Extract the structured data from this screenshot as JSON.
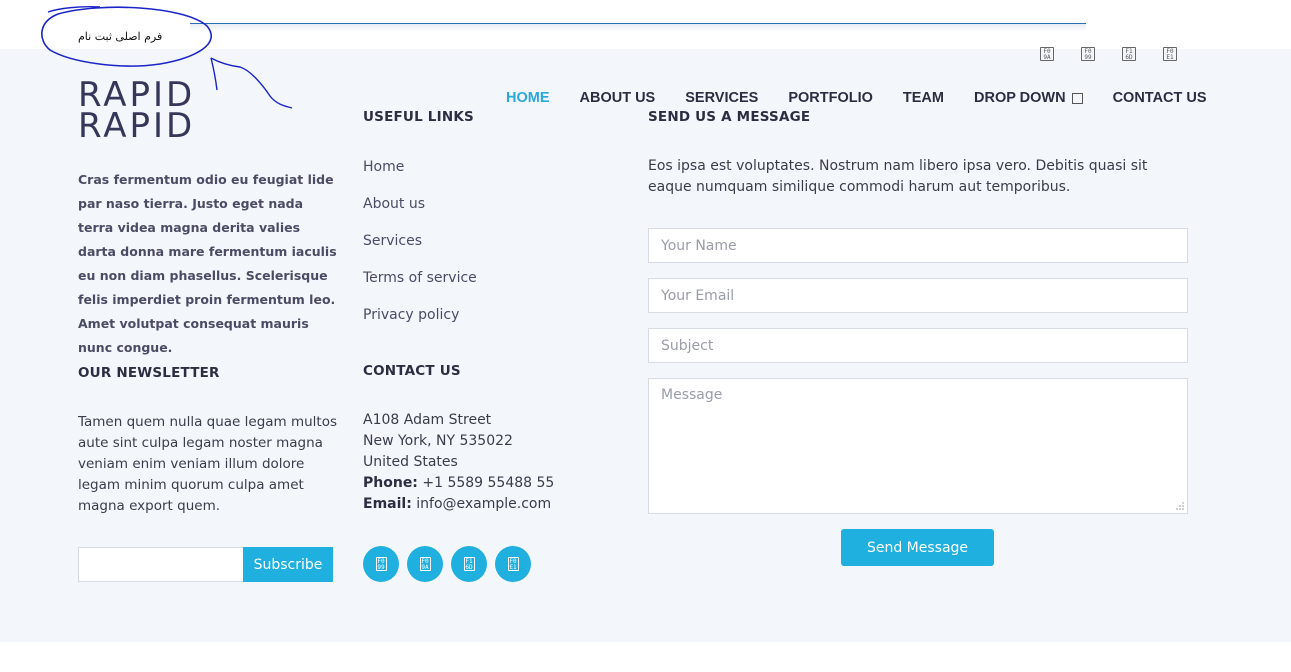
{
  "annotation": {
    "text": "فرم اصلی ثبت نام"
  },
  "top_social": [
    "facebook-icon",
    "twitter-icon",
    "instagram-icon",
    "linkedin-icon"
  ],
  "nav": {
    "items": [
      {
        "label": "HOME",
        "active": true
      },
      {
        "label": "ABOUT US"
      },
      {
        "label": "SERVICES"
      },
      {
        "label": "PORTFOLIO"
      },
      {
        "label": "TEAM"
      },
      {
        "label": "DROP DOWN"
      },
      {
        "label": "CONTACT US"
      }
    ]
  },
  "logo": {
    "line1": "RAPID",
    "line2": "RAPID"
  },
  "about": {
    "text": "Cras fermentum odio eu feugiat lide par naso tierra. Justo eget nada terra videa magna derita valies darta donna mare fermentum iaculis eu non diam phasellus. Scelerisque felis imperdiet proin fermentum leo. Amet volutpat consequat mauris nunc congue."
  },
  "newsletter": {
    "heading": "OUR NEWSLETTER",
    "text": "Tamen quem nulla quae legam multos aute sint culpa legam noster magna veniam enim veniam illum dolore legam minim quorum culpa amet magna export quem.",
    "button": "Subscribe"
  },
  "useful_links": {
    "heading": "USEFUL LINKS",
    "items": [
      "Home",
      "About us",
      "Services",
      "Terms of service",
      "Privacy policy"
    ]
  },
  "contact": {
    "heading": "CONTACT US",
    "street": "A108 Adam Street",
    "city": "New York, NY 535022",
    "country": "United States",
    "phone_label": "Phone:",
    "phone": " +1 5589 55488 55",
    "email_label": "Email:",
    "email": " info@example.com"
  },
  "round_social": [
    "twitter-icon",
    "facebook-icon",
    "instagram-icon",
    "linkedin-icon"
  ],
  "message": {
    "heading": "SEND US A MESSAGE",
    "text": "Eos ipsa est voluptates. Nostrum nam libero ipsa vero. Debitis quasi sit eaque numquam similique commodi harum aut temporibus.",
    "name_placeholder": "Your Name",
    "email_placeholder": "Your Email",
    "subject_placeholder": "Subject",
    "message_placeholder": "Message",
    "button": "Send Message"
  },
  "colors": {
    "accent": "#1fb0df",
    "heading": "#2b2d42",
    "background": "#f3f6fa",
    "annotation": "#1a25c9"
  }
}
